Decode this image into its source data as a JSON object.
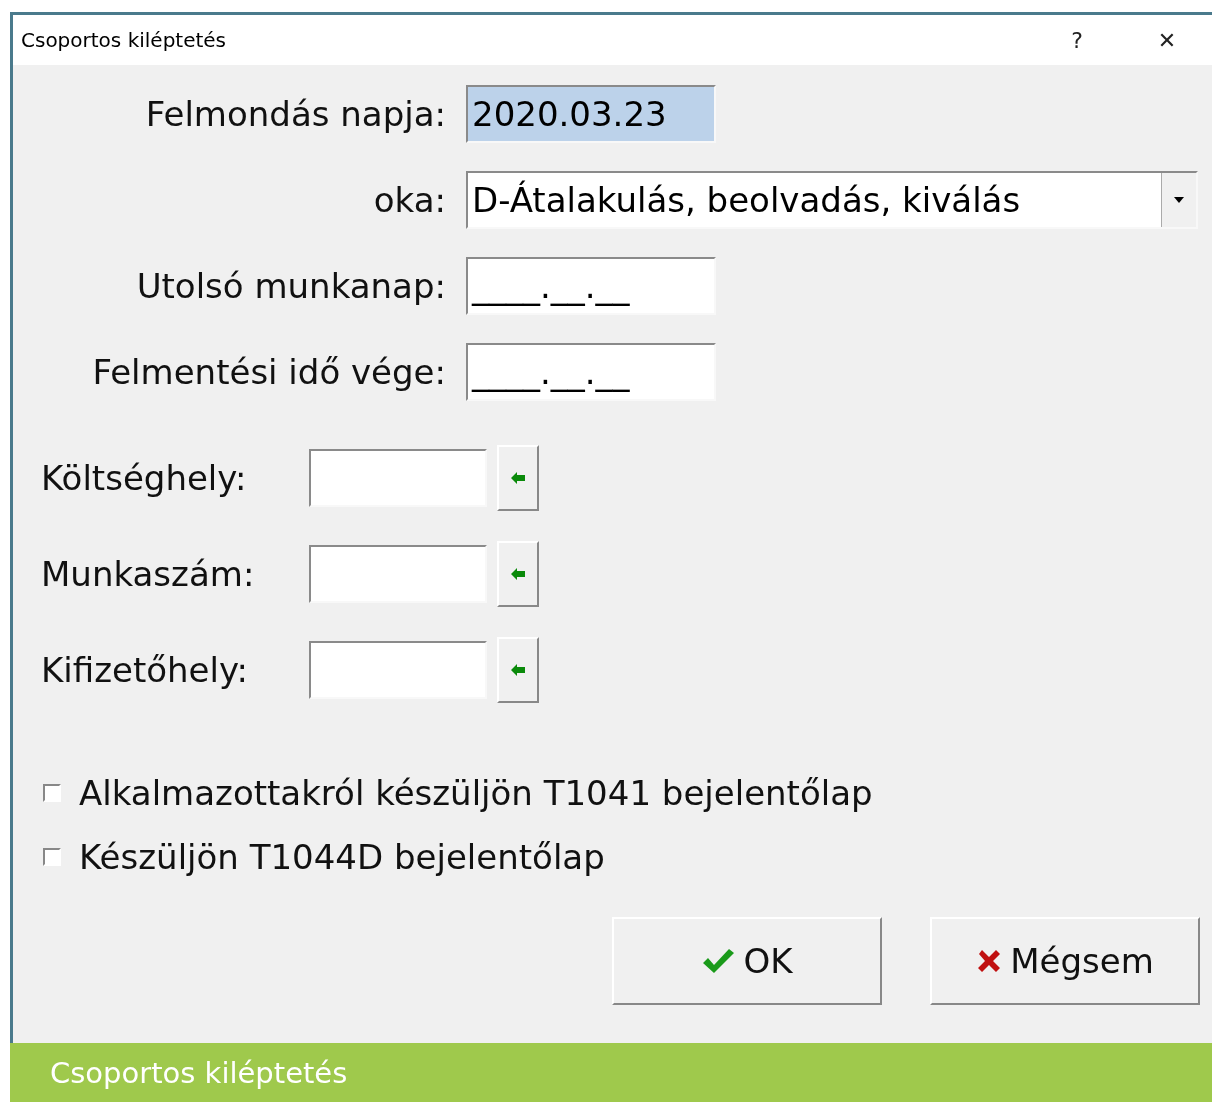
{
  "window": {
    "title": "Csoportos kiléptetés",
    "help": "?",
    "close": "✕"
  },
  "date_rows": [
    {
      "kind": "text",
      "label": "Felmondás napja:",
      "value": "2020.03.23",
      "focused": true
    },
    {
      "kind": "combo",
      "label": "oka:",
      "value": "D-Átalakulás, beolvadás, kiválás",
      "focused": false
    },
    {
      "kind": "text",
      "label": "Utolsó munkanap:",
      "value": "____.__.__",
      "focused": false
    },
    {
      "kind": "text",
      "label": "Felmentési idő vége:",
      "value": "____.__.__",
      "focused": false
    }
  ],
  "picker_rows": [
    {
      "label": "Költséghely:"
    },
    {
      "label": "Munkaszám:"
    },
    {
      "label": "Kifizetőhely:"
    }
  ],
  "checkboxes": [
    {
      "label": "Alkalmazottakról készüljön T1041 bejelentőlap",
      "checked": false
    },
    {
      "label": "Készüljön T1044D bejelentőlap",
      "checked": false
    }
  ],
  "buttons": [
    {
      "kind": "ok",
      "label": "OK"
    },
    {
      "kind": "cancel",
      "label": "Mégsem"
    }
  ],
  "status_bar": {
    "text": "Csoportos kiléptetés"
  }
}
